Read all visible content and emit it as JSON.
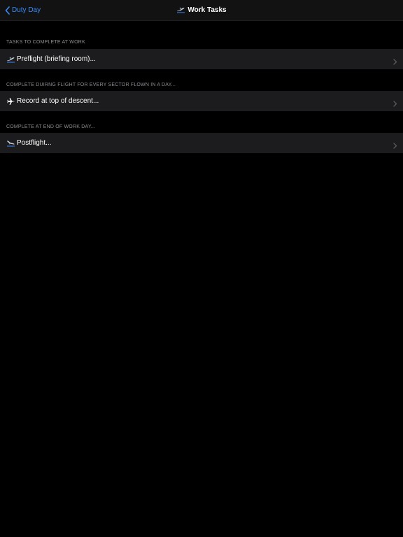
{
  "navbar": {
    "back_label": "Duty Day",
    "title": "Work Tasks",
    "title_icon": "plane-takeoff-icon",
    "accent_color": "#3b8af7"
  },
  "sections": [
    {
      "header": "TASKS TO COMPLETE AT WORK",
      "row": {
        "label": "Preflight (briefing room)...",
        "icon": "plane-takeoff-icon"
      }
    },
    {
      "header": "COMPLETE DUIRNG FLIGHT FOR EVERY SECTOR FLOWN IN A DAY...",
      "row": {
        "label": "Record at top of descent...",
        "icon": "airplane-icon"
      }
    },
    {
      "header": "COMPLETE AT END OF WORK DAY...",
      "row": {
        "label": "Postflight...",
        "icon": "plane-landing-icon"
      }
    }
  ]
}
